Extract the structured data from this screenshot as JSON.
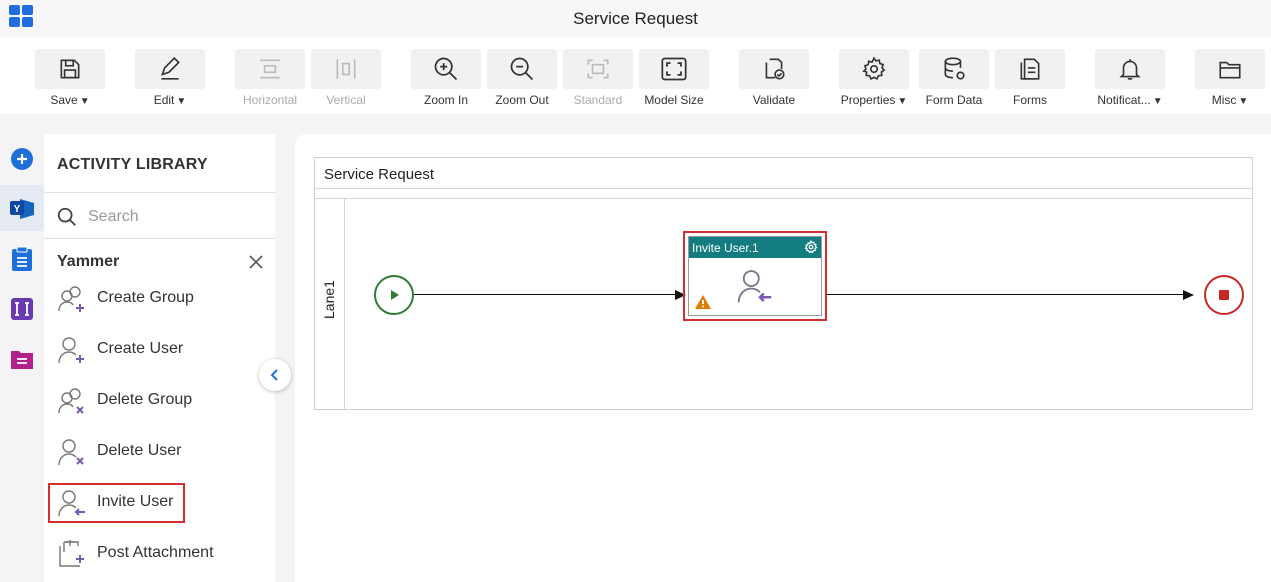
{
  "app": {
    "title": "Service Request"
  },
  "toolbar": {
    "buttons": [
      {
        "id": "save",
        "label": "Save",
        "icon": "save-icon",
        "has_menu": true,
        "disabled": false
      },
      {
        "id": "edit",
        "label": "Edit",
        "icon": "pencil-icon",
        "has_menu": true,
        "disabled": false
      },
      {
        "id": "horizontal",
        "label": "Horizontal",
        "icon": "horizontal-layout-icon",
        "has_menu": false,
        "disabled": true
      },
      {
        "id": "vertical",
        "label": "Vertical",
        "icon": "vertical-layout-icon",
        "has_menu": false,
        "disabled": true
      },
      {
        "id": "zoom_in",
        "label": "Zoom In",
        "icon": "zoom-in-icon",
        "has_menu": false,
        "disabled": false
      },
      {
        "id": "zoom_out",
        "label": "Zoom Out",
        "icon": "zoom-out-icon",
        "has_menu": false,
        "disabled": false
      },
      {
        "id": "standard",
        "label": "Standard",
        "icon": "standard-size-icon",
        "has_menu": false,
        "disabled": true
      },
      {
        "id": "model_size",
        "label": "Model Size",
        "icon": "fit-to-screen-icon",
        "has_menu": false,
        "disabled": false
      },
      {
        "id": "validate",
        "label": "Validate",
        "icon": "validate-icon",
        "has_menu": false,
        "disabled": false
      },
      {
        "id": "properties",
        "label": "Properties",
        "icon": "gear-icon",
        "has_menu": true,
        "disabled": false
      },
      {
        "id": "form_data",
        "label": "Form Data",
        "icon": "database-icon",
        "has_menu": false,
        "disabled": false
      },
      {
        "id": "forms",
        "label": "Forms",
        "icon": "forms-icon",
        "has_menu": false,
        "disabled": false
      },
      {
        "id": "notifications",
        "label": "Notificat...",
        "icon": "bell-icon",
        "has_menu": true,
        "disabled": false
      },
      {
        "id": "misc",
        "label": "Misc",
        "icon": "folder-icon",
        "has_menu": true,
        "disabled": false
      }
    ]
  },
  "left_rail": {
    "items": [
      {
        "icon": "add-circle-icon",
        "active": false
      },
      {
        "icon": "yammer-icon",
        "active": true
      },
      {
        "icon": "clipboard-icon",
        "active": false
      },
      {
        "icon": "text-fields-icon",
        "active": false
      },
      {
        "icon": "form-folder-icon",
        "active": false
      }
    ]
  },
  "library": {
    "title": "ACTIVITY LIBRARY",
    "search_placeholder": "Search",
    "category": "Yammer",
    "activities": [
      {
        "label": "Create Group",
        "icon": "create-group-icon",
        "selected": false
      },
      {
        "label": "Create User",
        "icon": "create-user-icon",
        "selected": false
      },
      {
        "label": "Delete Group",
        "icon": "delete-group-icon",
        "selected": false
      },
      {
        "label": "Delete User",
        "icon": "delete-user-icon",
        "selected": false
      },
      {
        "label": "Invite User",
        "icon": "invite-user-icon",
        "selected": true
      },
      {
        "label": "Post Attachment",
        "icon": "post-attachment-icon",
        "selected": false
      }
    ]
  },
  "canvas": {
    "pool_title": "Service Request",
    "lane_label": "Lane1",
    "task": {
      "title": "Invite User.1",
      "has_warning": true
    }
  },
  "colors": {
    "accent": "#1e6fd9",
    "task_header": "#127c80",
    "selection": "#d32f2f",
    "start_event": "#2e7d32",
    "end_event": "#c62828",
    "activity_icon": "#7a5ab0",
    "warning": "#e07b00"
  }
}
